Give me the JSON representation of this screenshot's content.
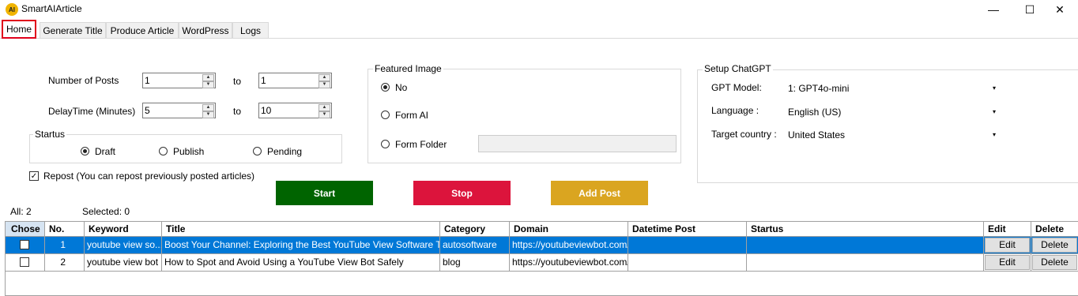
{
  "app": {
    "title": "SmartAIArticle",
    "icon_letters": "AI"
  },
  "window": {
    "minimize": "—",
    "maximize": "☐",
    "close": "✕"
  },
  "tabs": [
    "Home",
    "Generate Title",
    "Produce Article",
    "WordPress",
    "Logs"
  ],
  "form": {
    "num_posts_label": "Number of Posts",
    "num_posts_from": "1",
    "num_posts_to": "1",
    "delay_label": "DelayTime (Minutes)",
    "delay_from": "5",
    "delay_to": "10",
    "to_label": "to",
    "status_group": "Startus",
    "status_options": [
      "Draft",
      "Publish",
      "Pending"
    ],
    "status_selected": "Draft",
    "repost_label": "Repost (You can repost previously posted articles)",
    "repost_checked": true
  },
  "featured_image": {
    "group": "Featured Image",
    "options": [
      "No",
      "Form AI",
      "Form Folder"
    ],
    "selected": "No",
    "folder_path": ""
  },
  "chatgpt": {
    "group": "Setup ChatGPT",
    "model_label": "GPT Model:",
    "model_value": "1: GPT4o-mini",
    "language_label": "Language :",
    "language_value": "English (US)",
    "country_label": "Target country :",
    "country_value": "United States"
  },
  "actions": {
    "start": "Start",
    "stop": "Stop",
    "add_post": "Add Post",
    "colors": {
      "start": "#006400",
      "stop": "#dc143c",
      "add_post": "#daa520"
    }
  },
  "counts": {
    "all": "All: 2",
    "selected": "Selected: 0"
  },
  "table": {
    "columns": [
      "Chose",
      "No.",
      "Keyword",
      "Title",
      "Category",
      "Domain",
      "Datetime Post",
      "Startus",
      "Edit",
      "Delete"
    ],
    "rows": [
      {
        "no": "1",
        "keyword": "youtube view so...",
        "title": "Boost Your Channel: Exploring the Best YouTube View Software Tools",
        "category": "autosoftware",
        "domain": "https://youtubeviewbot.com/",
        "datetime": "",
        "status": "",
        "edit": "Edit",
        "delete": "Delete",
        "selected": true
      },
      {
        "no": "2",
        "keyword": "youtube view bot",
        "title": "How to Spot and Avoid Using a YouTube View Bot Safely",
        "category": "blog",
        "domain": "https://youtubeviewbot.com/",
        "datetime": "",
        "status": "",
        "edit": "Edit",
        "delete": "Delete",
        "selected": false
      }
    ]
  }
}
